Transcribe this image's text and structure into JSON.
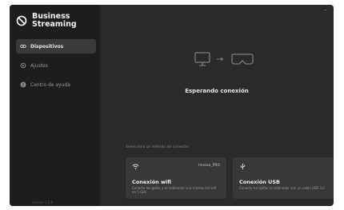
{
  "app": {
    "title": "Business Streaming",
    "version": "Versión 1.0.0"
  },
  "sidebar": {
    "items": [
      {
        "label": "Dispositivos",
        "icon": "glasses-icon",
        "active": true
      },
      {
        "label": "Ajustes",
        "icon": "gear-icon",
        "active": false
      },
      {
        "label": "Centro de ayuda",
        "icon": "help-icon",
        "active": false
      }
    ]
  },
  "window": {
    "minimize_glyph": "–"
  },
  "main": {
    "status": "Esperando conexión",
    "method_label": "Selecciona un método de conexión",
    "cards": [
      {
        "icon": "wifi-icon",
        "title": "Conexión wifi",
        "network": "Innova_PRO",
        "desc": "Conecta las gafas y el ordenador a la misma red wifi en 5 GHz"
      },
      {
        "icon": "usb-icon",
        "title": "Conexión USB",
        "desc": "Conecta tus gafas al ordenador con un cable USB 3.0"
      }
    ]
  },
  "colors": {
    "background": "#2a2a2a",
    "sidebar": "#1d1d1d",
    "card": "#383838",
    "active_item": "#3a3a3a"
  }
}
